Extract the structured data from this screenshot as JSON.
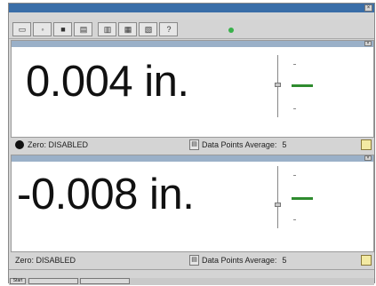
{
  "window": {
    "title": "",
    "close_glyph": "×"
  },
  "menu": {
    "items": []
  },
  "toolbar": {
    "buttons": [
      {
        "icon": "record-icon",
        "glyph": ""
      },
      {
        "icon": "zero-icon",
        "glyph": ""
      },
      {
        "icon": "stop-icon",
        "glyph": ""
      },
      {
        "icon": "chart-icon",
        "glyph": ""
      },
      {
        "icon": "print-icon",
        "glyph": ""
      },
      {
        "icon": "settings-icon",
        "glyph": ""
      },
      {
        "icon": "export-icon",
        "glyph": ""
      },
      {
        "icon": "help-icon",
        "glyph": ""
      }
    ],
    "status_color": "#39b14b"
  },
  "panels": [
    {
      "reading": "0.004 in.",
      "zero_label": "Zero: DISABLED",
      "avg_label": "Data Points Average:",
      "avg_value": "5",
      "gauge_level": 0.5
    },
    {
      "reading": "-0.008 in.",
      "zero_label": "Zero: DISABLED",
      "avg_label": "Data Points Average:",
      "avg_value": "5",
      "gauge_level": 0.5
    }
  ],
  "footer": {
    "line1": "",
    "line2": "",
    "start": "Start",
    "tasks": [
      "",
      ""
    ],
    "clock": ""
  },
  "colors": {
    "accent": "#3a6ea8",
    "pointer": "#2e8b2e",
    "note": "#f3eaa3"
  }
}
